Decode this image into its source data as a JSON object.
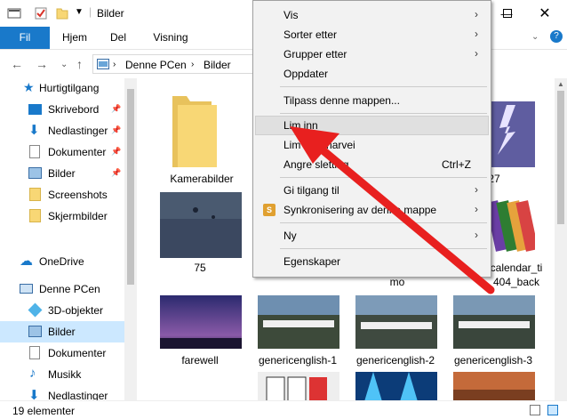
{
  "window": {
    "title": "Bilder",
    "minimize_icon": "minimize-icon",
    "maximize_icon": "maximize-icon",
    "close_icon": "close-icon"
  },
  "ribbon": {
    "tabs": [
      "Fil",
      "Hjem",
      "Del",
      "Visning"
    ],
    "accent_color": "#1979ca"
  },
  "address": {
    "crumbs": [
      "Denne PCen",
      "Bilder"
    ]
  },
  "sidebar": {
    "items": [
      {
        "label": "Hurtigtilgang",
        "icon": "star-icon",
        "pinned": false
      },
      {
        "label": "Skrivebord",
        "icon": "desktop-icon",
        "pinned": true
      },
      {
        "label": "Nedlastinger",
        "icon": "download-icon",
        "pinned": true
      },
      {
        "label": "Dokumenter",
        "icon": "document-icon",
        "pinned": true
      },
      {
        "label": "Bilder",
        "icon": "pictures-icon",
        "pinned": true
      },
      {
        "label": "Screenshots",
        "icon": "folder-icon",
        "pinned": false
      },
      {
        "label": "Skjermbilder",
        "icon": "folder-icon",
        "pinned": false
      },
      {
        "label": "OneDrive",
        "icon": "cloud-icon",
        "pinned": false
      },
      {
        "label": "Denne PCen",
        "icon": "computer-icon",
        "pinned": false
      },
      {
        "label": "3D-objekter",
        "icon": "cube-icon",
        "pinned": false
      },
      {
        "label": "Bilder",
        "icon": "pictures-icon",
        "pinned": false,
        "selected": true
      },
      {
        "label": "Dokumenter",
        "icon": "document-icon",
        "pinned": false
      },
      {
        "label": "Musikk",
        "icon": "music-icon",
        "pinned": false
      },
      {
        "label": "Nedlastinger",
        "icon": "download-icon",
        "pinned": false
      }
    ]
  },
  "files": [
    {
      "label": "Kamerabilder"
    },
    {
      "label": "27"
    },
    {
      "label": "75"
    },
    {
      "label": "mo"
    },
    {
      "label": "calendar_ti"
    },
    {
      "label": "404_back"
    },
    {
      "label": "farewell"
    },
    {
      "label": "genericenglish-1"
    },
    {
      "label": "genericenglish-2"
    },
    {
      "label": "genericenglish-3"
    }
  ],
  "status": {
    "count": "19 elementer"
  },
  "context_menu": {
    "items": [
      {
        "label": "Vis",
        "submenu": true
      },
      {
        "label": "Sorter etter",
        "submenu": true
      },
      {
        "label": "Grupper etter",
        "submenu": true
      },
      {
        "label": "Oppdater",
        "submenu": false
      },
      {
        "label": "Tilpass denne mappen...",
        "submenu": false
      },
      {
        "label": "Lim inn",
        "submenu": false,
        "highlighted": true
      },
      {
        "label": "Lim inn snarvei",
        "submenu": false
      },
      {
        "label": "Angre sletting",
        "shortcut": "Ctrl+Z"
      },
      {
        "label": "Gi tilgang til",
        "submenu": true
      },
      {
        "label": "Synkronisering av denne mappe",
        "submenu": true,
        "icon": "sync-icon"
      },
      {
        "label": "Ny",
        "submenu": true
      },
      {
        "label": "Egenskaper",
        "submenu": false
      }
    ]
  },
  "annotation": {
    "arrow_color": "#e8201f"
  }
}
